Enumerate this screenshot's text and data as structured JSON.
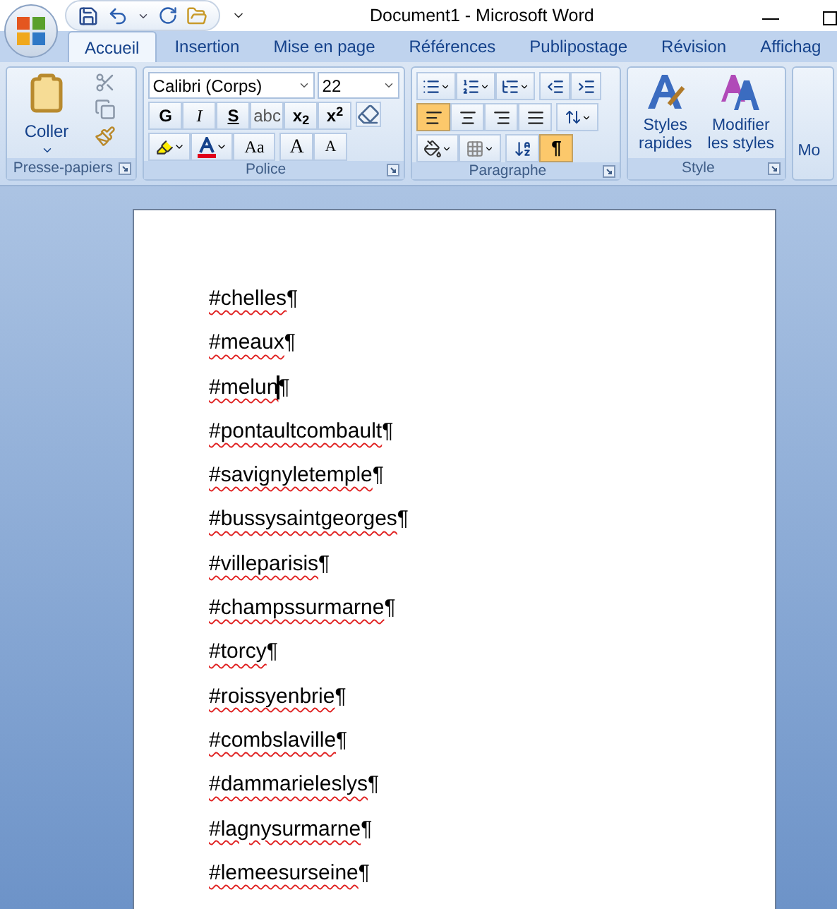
{
  "window": {
    "title": "Document1 - Microsoft Word"
  },
  "tabs": [
    {
      "label": "Accueil",
      "selected": true
    },
    {
      "label": "Insertion",
      "selected": false
    },
    {
      "label": "Mise en page",
      "selected": false
    },
    {
      "label": "Références",
      "selected": false
    },
    {
      "label": "Publipostage",
      "selected": false
    },
    {
      "label": "Révision",
      "selected": false
    },
    {
      "label": "Affichag",
      "selected": false
    }
  ],
  "clipboard": {
    "title": "Presse-papiers",
    "paste": "Coller"
  },
  "font": {
    "title": "Police",
    "family": "Calibri (Corps)",
    "size": "22",
    "format_buttons": [
      {
        "label": "G",
        "kind": "bold"
      },
      {
        "label": "I",
        "kind": "italic"
      },
      {
        "label": "S",
        "kind": "underline"
      },
      {
        "label": "abc",
        "kind": "strike"
      },
      {
        "label": "x$_{2}$",
        "kind": "plain"
      },
      {
        "label": "x$^{2}$",
        "kind": "plain"
      }
    ],
    "case_button": "Aa",
    "grow_button": "A",
    "shrink_button": "A"
  },
  "paragraph": {
    "title": "Paragraphe",
    "pilcrow": "¶",
    "pilcrow_selected": true,
    "align": [
      {
        "kind": "left",
        "selected": true
      },
      {
        "kind": "center",
        "selected": false
      },
      {
        "kind": "right",
        "selected": false
      },
      {
        "kind": "justify",
        "selected": false
      }
    ]
  },
  "style": {
    "title": "Style",
    "quick": "Styles rapides",
    "change": "Modifier les styles"
  },
  "next_group": {
    "label": "Mo"
  },
  "document": {
    "lines": [
      {
        "word": "#chelles",
        "mark": "¶",
        "misspelled": true,
        "caret": false
      },
      {
        "word": "#meaux",
        "mark": "¶",
        "misspelled": true,
        "caret": false
      },
      {
        "word": "#melun",
        "mark": "¶",
        "misspelled": true,
        "caret": true
      },
      {
        "word": "#pontaultcombault",
        "mark": "¶",
        "misspelled": true,
        "caret": false
      },
      {
        "word": "#savignyletemple",
        "mark": "¶",
        "misspelled": true,
        "caret": false
      },
      {
        "word": "#bussysaintgeorges",
        "mark": "¶",
        "misspelled": true,
        "caret": false
      },
      {
        "word": "#villeparisis",
        "mark": "¶",
        "misspelled": true,
        "caret": false
      },
      {
        "word": "#champssurmarne",
        "mark": "¶",
        "misspelled": true,
        "caret": false
      },
      {
        "word": "#torcy",
        "mark": "¶",
        "misspelled": true,
        "caret": false
      },
      {
        "word": "#roissyenbrie",
        "mark": "¶",
        "misspelled": true,
        "caret": false
      },
      {
        "word": "#combslaville",
        "mark": "¶",
        "misspelled": true,
        "caret": false
      },
      {
        "word": "#dammarieleslys",
        "mark": "¶",
        "misspelled": true,
        "caret": false
      },
      {
        "word": "#lagnysurmarne",
        "mark": "¶",
        "misspelled": true,
        "caret": false
      },
      {
        "word": "#lemeesurseine",
        "mark": "¶",
        "misspelled": true,
        "caret": false
      }
    ]
  }
}
